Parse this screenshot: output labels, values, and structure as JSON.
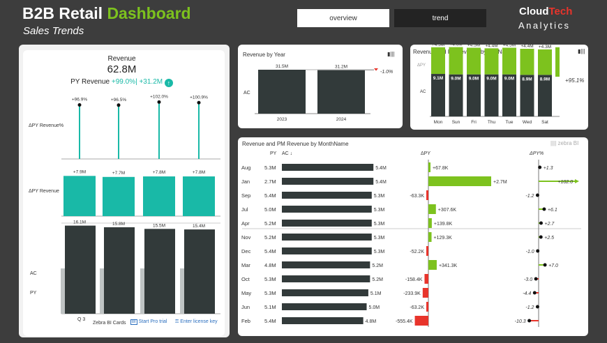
{
  "header": {
    "title_main": "B2B Retail",
    "title_accent": "Dashboard",
    "subtitle": "Sales Trends",
    "nav": [
      {
        "label": "overview"
      },
      {
        "label": "trend"
      }
    ],
    "logo_cloud": "Cloud",
    "logo_tech": "Tech",
    "logo_analytics": "Analytics"
  },
  "colors": {
    "accent_green": "#7dc21e",
    "teal": "#19b9a7",
    "dark": "#323a3a",
    "red": "#e8342b"
  },
  "left_card": {
    "revenue_label": "Revenue",
    "revenue_value": "62.8M",
    "py_label": "PY Revenue",
    "py_pct": "+99.0%",
    "py_abs": "+31.2M",
    "row_label_pct": "ΔPY Revenue%",
    "row_label_abs": "ΔPY Revenue",
    "row_label_ac": "AC",
    "row_label_py": "PY",
    "footer": {
      "period": "Q 3",
      "brand": "Zebra BI Cards",
      "trial": "Start Pro trial",
      "license": "Enter license key"
    }
  },
  "year_card": {
    "title": "Revenue by Year",
    "row_label": "AC"
  },
  "day_card": {
    "title": "Revenue and PY Revenue by DayName",
    "row_label_dpy": "ΔPY",
    "row_label_ac": "AC",
    "total_delta": "+95.1%"
  },
  "month_card": {
    "title": "Revenue and PM Revenue by MonthName",
    "col_py": "PY",
    "col_ac": "AC ↓",
    "col_dpy": "ΔPY",
    "col_dpy_pct": "ΔPY%",
    "watermark": "zebra BI",
    "months": [
      {
        "month": "Aug",
        "py": "5.3M",
        "ac": "5.4M",
        "ac_v": 5.4,
        "dpy": "+67.8K",
        "dpy_v": 67.8,
        "pct": "+1.3",
        "pct_v": 1.3
      },
      {
        "month": "Jan",
        "py": "2.7M",
        "ac": "5.4M",
        "ac_v": 5.4,
        "dpy": "+2.7M",
        "dpy_v": 2700,
        "pct": "+102.0",
        "pct_v": 102.0
      },
      {
        "month": "Sep",
        "py": "5.4M",
        "ac": "5.3M",
        "ac_v": 5.3,
        "dpy": "-63.3K",
        "dpy_v": -63.3,
        "pct": "-1.2",
        "pct_v": -1.2
      },
      {
        "month": "Jul",
        "py": "5.0M",
        "ac": "5.3M",
        "ac_v": 5.3,
        "dpy": "+307.6K",
        "dpy_v": 307.6,
        "pct": "+6.1",
        "pct_v": 6.1
      },
      {
        "month": "Apr",
        "py": "5.2M",
        "ac": "5.3M",
        "ac_v": 5.3,
        "dpy": "+139.8K",
        "dpy_v": 139.8,
        "pct": "+2.7",
        "pct_v": 2.7
      },
      {
        "month": "Nov",
        "py": "5.2M",
        "ac": "5.3M",
        "ac_v": 5.3,
        "dpy": "+129.3K",
        "dpy_v": 129.3,
        "pct": "+2.5",
        "pct_v": 2.5
      },
      {
        "month": "Dec",
        "py": "5.4M",
        "ac": "5.3M",
        "ac_v": 5.3,
        "dpy": "-52.2K",
        "dpy_v": -52.2,
        "pct": "-1.0",
        "pct_v": -1.0
      },
      {
        "month": "Mar",
        "py": "4.8M",
        "ac": "5.2M",
        "ac_v": 5.2,
        "dpy": "+341.3K",
        "dpy_v": 341.3,
        "pct": "+7.0",
        "pct_v": 7.0
      },
      {
        "month": "Oct",
        "py": "5.3M",
        "ac": "5.2M",
        "ac_v": 5.2,
        "dpy": "-158.4K",
        "dpy_v": -158.4,
        "pct": "-3.0",
        "pct_v": -3.0
      },
      {
        "month": "May",
        "py": "5.3M",
        "ac": "5.1M",
        "ac_v": 5.1,
        "dpy": "-233.9K",
        "dpy_v": -233.9,
        "pct": "-4.4",
        "pct_v": -4.4
      },
      {
        "month": "Jun",
        "py": "5.1M",
        "ac": "5.0M",
        "ac_v": 5.0,
        "dpy": "-63.2K",
        "dpy_v": -63.2,
        "pct": "-1.2",
        "pct_v": -1.2
      },
      {
        "month": "Feb",
        "py": "5.4M",
        "ac": "4.8M",
        "ac_v": 4.8,
        "dpy": "-555.4K",
        "dpy_v": -555.4,
        "pct": "-10.3",
        "pct_v": -10.3
      }
    ]
  },
  "chart_data": [
    {
      "type": "bar",
      "chart": "quarter-revenue",
      "categories": [
        "Q 3"
      ],
      "series": [
        {
          "name": "ΔPY Revenue%",
          "values": [
            96.9,
            96.5,
            102.0,
            100.9
          ],
          "labels": [
            "+96.9%",
            "+96.5%",
            "+102.0%",
            "+100.9%"
          ]
        },
        {
          "name": "ΔPY Revenue",
          "values": [
            7.9,
            7.7,
            7.8,
            7.8
          ],
          "labels": [
            "+7.9M",
            "+7.7M",
            "+7.8M",
            "+7.8M"
          ]
        },
        {
          "name": "AC",
          "values": [
            16.1,
            15.8,
            15.5,
            15.4
          ],
          "labels": [
            "16.1M",
            "15.8M",
            "15.5M",
            "15.4M"
          ]
        }
      ]
    },
    {
      "type": "bar",
      "chart": "revenue-by-year",
      "categories": [
        "2023",
        "2024"
      ],
      "values": [
        31.5,
        31.2
      ],
      "labels": [
        "31.5M",
        "31.2M"
      ],
      "delta_label": "-1.0%"
    },
    {
      "type": "bar",
      "chart": "revenue-by-dayname",
      "categories": [
        "Mon",
        "Sun",
        "Fri",
        "Thu",
        "Tue",
        "Wed",
        "Sat"
      ],
      "series": [
        {
          "name": "AC",
          "values": [
            9.1,
            9.0,
            9.0,
            9.0,
            9.0,
            8.9,
            8.9
          ],
          "labels": [
            "9.1M",
            "9.0M",
            "9.0M",
            "9.0M",
            "9.0M",
            "8.9M",
            "8.9M"
          ]
        },
        {
          "name": "ΔPY",
          "values": [
            4.5,
            4.6,
            4.5,
            4.4,
            4.5,
            4.4,
            4.3
          ],
          "labels": [
            "+4.5M",
            "+4.6M",
            "+4.5M",
            "+4.4M",
            "+4.5M",
            "+4.4M",
            "+4.3M"
          ]
        }
      ]
    }
  ]
}
